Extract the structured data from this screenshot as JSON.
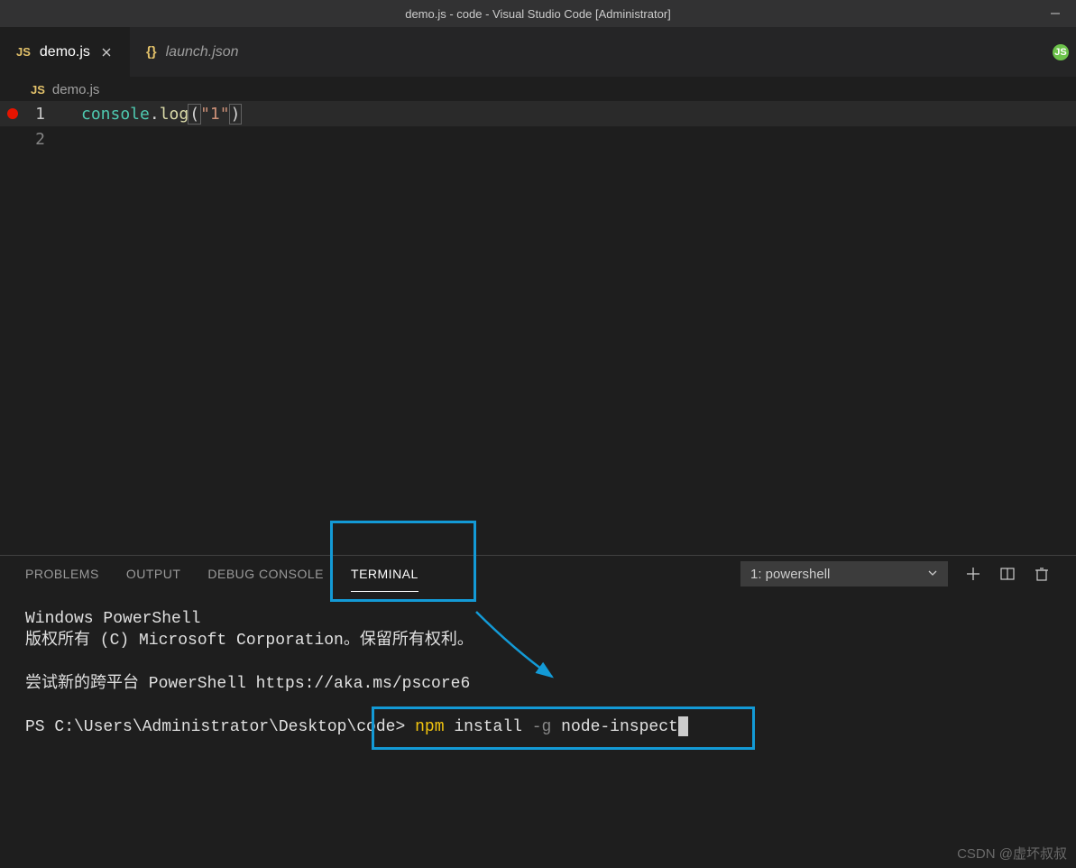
{
  "window": {
    "title": "demo.js - code - Visual Studio Code [Administrator]"
  },
  "tabs": [
    {
      "icon": "JS",
      "label": "demo.js",
      "active": true,
      "dirty": false,
      "closable": true
    },
    {
      "icon": "{}",
      "label": "launch.json",
      "active": false,
      "italic": true
    }
  ],
  "breadcrumb": {
    "icon": "JS",
    "file": "demo.js"
  },
  "editor": {
    "lines": [
      {
        "num": "1",
        "breakpoint": true,
        "tokens": [
          {
            "t": "console",
            "c": "obj"
          },
          {
            "t": ".",
            "c": "punc"
          },
          {
            "t": "log",
            "c": "fn"
          },
          {
            "t": "(",
            "c": "paren-hl"
          },
          {
            "t": "\"1\"",
            "c": "str"
          },
          {
            "t": ")",
            "c": "paren-hl"
          }
        ]
      },
      {
        "num": "2",
        "breakpoint": false,
        "tokens": []
      }
    ]
  },
  "panel": {
    "tabs": [
      "PROBLEMS",
      "OUTPUT",
      "DEBUG CONSOLE",
      "TERMINAL"
    ],
    "active_tab": "TERMINAL",
    "terminal_selector": "1: powershell"
  },
  "terminal": {
    "line1": "Windows PowerShell",
    "line2": "版权所有 (C) Microsoft Corporation。保留所有权利。",
    "line3": "尝试新的跨平台 PowerShell https://aka.ms/pscore6",
    "prompt": "PS C:\\Users\\Administrator\\Desktop\\code>",
    "cmd_npm": "npm",
    "cmd_install": "install",
    "cmd_flag": "-g",
    "cmd_pkg": "node-inspect"
  },
  "watermark": "CSDN @虚坏叔叔"
}
